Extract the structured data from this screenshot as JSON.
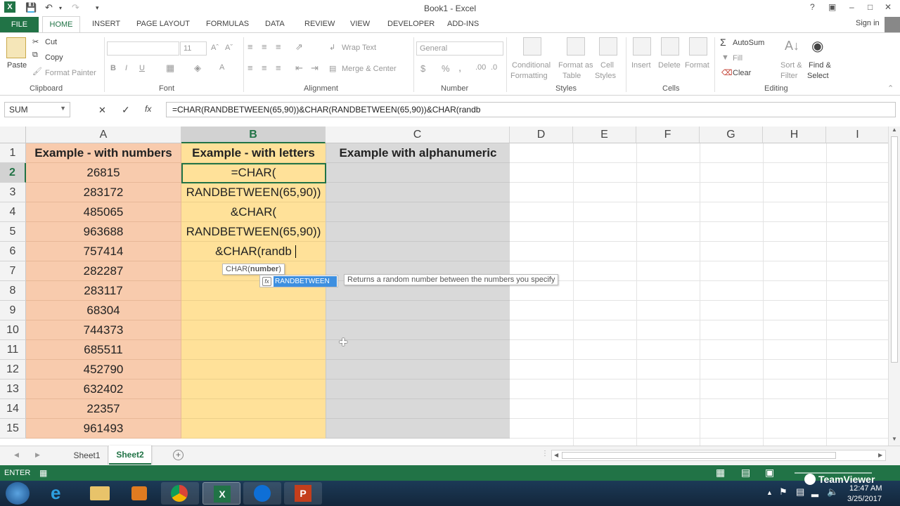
{
  "window": {
    "title": "Book1 - Excel",
    "sign_in": "Sign in",
    "help": "?",
    "restore_ribbon": "▣",
    "minimize": "–",
    "maximize": "□",
    "close": "✕"
  },
  "ribbon_tabs": [
    "FILE",
    "HOME",
    "INSERT",
    "PAGE LAYOUT",
    "FORMULAS",
    "DATA",
    "REVIEW",
    "VIEW",
    "DEVELOPER",
    "ADD-INS"
  ],
  "ribbon": {
    "clipboard": {
      "paste": "Paste",
      "cut": "Cut",
      "copy": "Copy",
      "format_painter": "Format Painter",
      "label": "Clipboard"
    },
    "font": {
      "size": "11",
      "bold": "B",
      "italic": "I",
      "underline": "U",
      "label": "Font"
    },
    "alignment": {
      "wrap_text": "Wrap Text",
      "merge_center": "Merge & Center",
      "label": "Alignment"
    },
    "number": {
      "format": "General",
      "currency": "$",
      "percent": "%",
      "comma": ",",
      "label": "Number"
    },
    "styles": {
      "conditional": "Conditional",
      "conditional2": "Formatting",
      "format_as": "Format as",
      "format_as2": "Table",
      "cell": "Cell",
      "cell2": "Styles",
      "label": "Styles"
    },
    "cells": {
      "insert": "Insert",
      "delete": "Delete",
      "format": "Format",
      "label": "Cells"
    },
    "editing": {
      "autosum": "AutoSum",
      "fill": "Fill",
      "clear": "Clear",
      "sort": "Sort &",
      "sort2": "Filter",
      "find": "Find &",
      "find2": "Select",
      "label": "Editing"
    }
  },
  "formula_bar": {
    "name_box": "SUM",
    "cancel": "✕",
    "enter": "✓",
    "fx": "fx",
    "content": "=CHAR(RANDBETWEEN(65,90))&CHAR(RANDBETWEEN(65,90))&CHAR(randb"
  },
  "columns": [
    "A",
    "B",
    "C",
    "D",
    "E",
    "F",
    "G",
    "H",
    "I"
  ],
  "rows": [
    "1",
    "2",
    "3",
    "4",
    "5",
    "6",
    "7",
    "8",
    "9",
    "10",
    "11",
    "12",
    "13",
    "14",
    "15"
  ],
  "headers": {
    "a": "Example - with numbers",
    "b": "Example - with letters",
    "c": "Example with alphanumeric"
  },
  "col_a_values": [
    "26815",
    "283172",
    "485065",
    "963688",
    "757414",
    "282287",
    "283117",
    "68304",
    "744373",
    "685511",
    "452790",
    "632402",
    "22357",
    "961493"
  ],
  "editing_cell": {
    "line1": "=CHAR(",
    "line2": "RANDBETWEEN(65,90))",
    "line3": "&CHAR(",
    "line4": "RANDBETWEEN(65,90))",
    "line5": "&CHAR(randb"
  },
  "tooltips": {
    "arg_hint_fn": "CHAR(",
    "arg_hint_arg": "number",
    "arg_hint_close": ")",
    "autocomplete_item": "RANDBETWEEN",
    "autocomplete_desc": "Returns a random number between the numbers you specify"
  },
  "sheets": [
    "Sheet1",
    "Sheet2"
  ],
  "active_sheet": "Sheet2",
  "status": {
    "mode": "ENTER"
  },
  "taskbar": {
    "teamviewer": "TeamViewer",
    "time": "12:47 AM",
    "date": "3/25/2017"
  },
  "colors": {
    "excel_green": "#217346",
    "col_a_fill": "#f8cbad",
    "col_b_fill": "#ffe199",
    "col_c_fill": "#d9d9d9"
  }
}
